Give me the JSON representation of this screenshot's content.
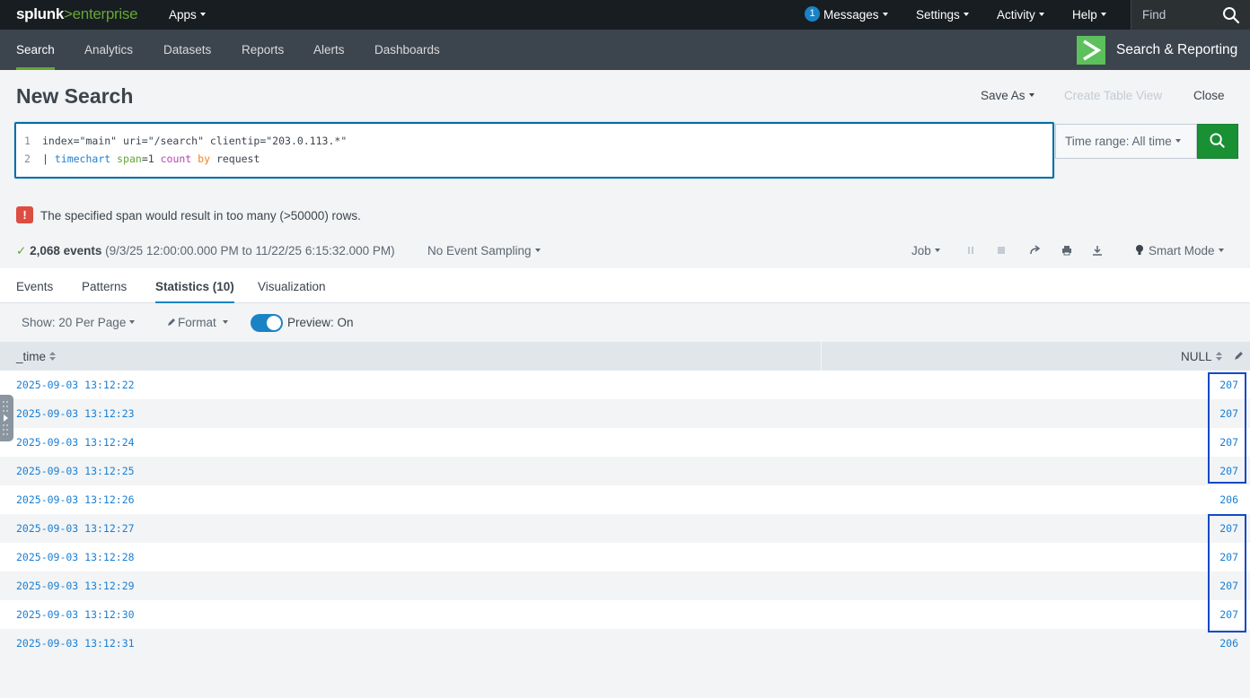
{
  "topbar": {
    "logo_main": "splunk",
    "logo_gt": ">",
    "logo_sub": "enterprise",
    "apps": "Apps",
    "messages_count": "1",
    "messages": "Messages",
    "settings": "Settings",
    "activity": "Activity",
    "help": "Help",
    "find_placeholder": "Find"
  },
  "appbar": {
    "tabs": [
      "Search",
      "Analytics",
      "Datasets",
      "Reports",
      "Alerts",
      "Dashboards"
    ],
    "active_tab": "Search",
    "app_title": "Search & Reporting"
  },
  "header": {
    "title": "New Search",
    "save_as": "Save As",
    "create_table_view": "Create Table View",
    "close": "Close"
  },
  "search": {
    "line1_num": "1",
    "line1": "index=\"main\" uri=\"/search\" clientip=\"203.0.113.*\"",
    "line2_num": "2",
    "line2_pipe": "| ",
    "line2_cmd": "timechart",
    "line2_arg": "span",
    "line2_eq": "=1 ",
    "line2_fn": "count",
    "line2_by": "by",
    "line2_field": " request",
    "time_range": "Time range: All time"
  },
  "error": {
    "icon": "!",
    "message": "The specified span would result in too many (>50000) rows."
  },
  "job": {
    "check": "✓",
    "events": "2,068 events",
    "range": "(9/3/25 12:00:00.000 PM to 11/22/25 6:15:32.000 PM)",
    "sampling": "No Event Sampling",
    "job_menu": "Job",
    "mode": "Smart Mode"
  },
  "tabs": {
    "events": "Events",
    "patterns": "Patterns",
    "statistics": "Statistics (10)",
    "visualization": "Visualization"
  },
  "toolbar": {
    "per_page": "Show: 20 Per Page",
    "format": "Format",
    "preview": "Preview: On"
  },
  "table": {
    "col_time": "_time",
    "col_value": "NULL",
    "rows": [
      {
        "time": "2025-09-03 13:12:22",
        "value": "207"
      },
      {
        "time": "2025-09-03 13:12:23",
        "value": "207"
      },
      {
        "time": "2025-09-03 13:12:24",
        "value": "207"
      },
      {
        "time": "2025-09-03 13:12:25",
        "value": "207"
      },
      {
        "time": "2025-09-03 13:12:26",
        "value": "206"
      },
      {
        "time": "2025-09-03 13:12:27",
        "value": "207"
      },
      {
        "time": "2025-09-03 13:12:28",
        "value": "207"
      },
      {
        "time": "2025-09-03 13:12:29",
        "value": "207"
      },
      {
        "time": "2025-09-03 13:12:30",
        "value": "207"
      },
      {
        "time": "2025-09-03 13:12:31",
        "value": "206"
      }
    ]
  },
  "colors": {
    "topbar": "#171d21",
    "appbar": "#3c444d",
    "accent_green": "#65a637",
    "link_blue": "#1a7fd4",
    "error_red": "#dc4e41",
    "highlight_box": "#1549c8"
  }
}
